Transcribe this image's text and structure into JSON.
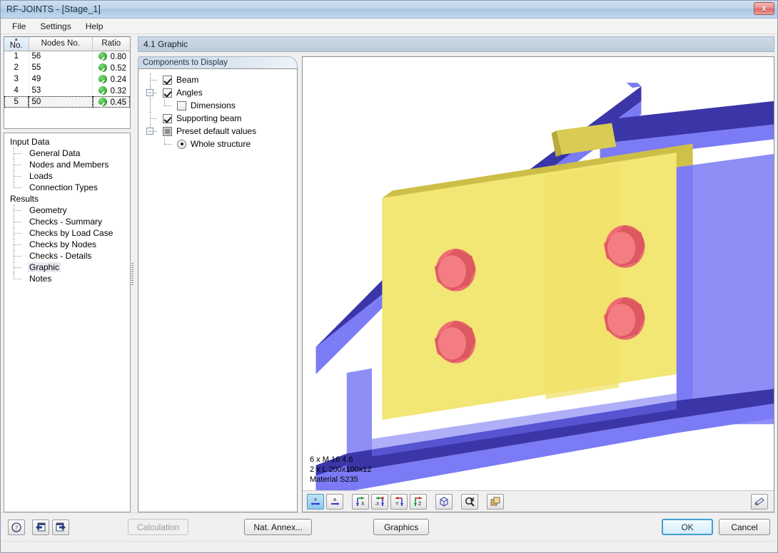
{
  "window": {
    "title": "RF-JOINTS - [Stage_1]",
    "close_label": "x"
  },
  "menu": {
    "items": [
      {
        "label": "File"
      },
      {
        "label": "Settings"
      },
      {
        "label": "Help"
      }
    ]
  },
  "results_table": {
    "columns": [
      "No.",
      "Nodes No.",
      "Ratio"
    ],
    "rows": [
      {
        "no": "1",
        "node": "56",
        "ratio": "0.80",
        "status": "ok",
        "selected": false
      },
      {
        "no": "2",
        "node": "55",
        "ratio": "0.52",
        "status": "ok",
        "selected": false
      },
      {
        "no": "3",
        "node": "49",
        "ratio": "0.24",
        "status": "ok",
        "selected": false
      },
      {
        "no": "4",
        "node": "53",
        "ratio": "0.32",
        "status": "ok",
        "selected": false
      },
      {
        "no": "5",
        "node": "50",
        "ratio": "0.45",
        "status": "ok",
        "selected": true
      }
    ]
  },
  "navigator": {
    "groups": [
      {
        "label": "Input Data",
        "items": [
          {
            "label": "General Data",
            "active": false
          },
          {
            "label": "Nodes and Members",
            "active": false
          },
          {
            "label": "Loads",
            "active": false
          },
          {
            "label": "Connection Types",
            "active": false
          }
        ]
      },
      {
        "label": "Results",
        "items": [
          {
            "label": "Geometry",
            "active": false
          },
          {
            "label": "Checks - Summary",
            "active": false
          },
          {
            "label": "Checks by Load Case",
            "active": false
          },
          {
            "label": "Checks by Nodes",
            "active": false
          },
          {
            "label": "Checks - Details",
            "active": false
          },
          {
            "label": "Graphic",
            "active": true
          },
          {
            "label": "Notes",
            "active": false
          }
        ]
      }
    ]
  },
  "page": {
    "header": "4.1 Graphic"
  },
  "components": {
    "group_title": "Components to Display",
    "nodes": [
      {
        "label": "Beam",
        "control": "checkbox",
        "checked": true,
        "level": 1,
        "expander": "none"
      },
      {
        "label": "Angles",
        "control": "checkbox",
        "checked": true,
        "level": 1,
        "expander": "minus"
      },
      {
        "label": "Dimensions",
        "control": "checkbox",
        "checked": false,
        "level": 2,
        "expander": "none"
      },
      {
        "label": "Supporting beam",
        "control": "checkbox",
        "checked": true,
        "level": 1,
        "expander": "none"
      },
      {
        "label": "Preset default values",
        "control": "checkbox-gray",
        "checked": false,
        "level": 1,
        "expander": "minus"
      },
      {
        "label": "Whole structure",
        "control": "radio",
        "checked": true,
        "level": 2,
        "expander": "none"
      }
    ]
  },
  "graphic": {
    "legend": {
      "line1": "6 x M 16 4.6",
      "line2": "2 x L 200x100x12",
      "line3": "Material S235"
    },
    "colors": {
      "beam_light": "#7b7bf5",
      "beam_dark": "#3b36a8",
      "angle_light": "#f2e675",
      "angle_dark": "#c8bb3c",
      "bolt": "#ef6d73",
      "background": "#ffffff"
    },
    "toolbar": [
      {
        "name": "view-xz-plane-icon",
        "label": "x",
        "active": true
      },
      {
        "name": "view-a-plane-icon",
        "label": "a",
        "active": false
      },
      {
        "name": "view-x-axis-icon",
        "label": "X",
        "active": false
      },
      {
        "name": "view-neg-x-axis-icon",
        "label": "-X",
        "active": false
      },
      {
        "name": "view-y-axis-icon",
        "label": "Y",
        "active": false
      },
      {
        "name": "view-z-axis-icon",
        "label": "Z",
        "active": false
      },
      {
        "name": "isometric-view-icon",
        "label": "",
        "active": false
      },
      {
        "name": "zoom-reset-icon",
        "label": "",
        "active": false
      },
      {
        "name": "layers-icon",
        "label": "",
        "active": false
      }
    ],
    "print_button": "print-icon"
  },
  "footer": {
    "help_icon": "help-icon",
    "prev_icon": "previous-icon",
    "next_icon": "next-icon",
    "calculation_label": "Calculation",
    "calculation_disabled": true,
    "nat_annex_label": "Nat. Annex...",
    "graphics_label": "Graphics",
    "ok_label": "OK",
    "cancel_label": "Cancel"
  }
}
